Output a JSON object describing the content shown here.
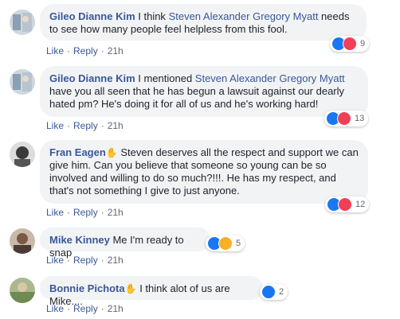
{
  "actions": {
    "like": "Like",
    "reply": "Reply",
    "dot": "·"
  },
  "comments": [
    {
      "author": "Gileo Dianne Kim",
      "pre": " I think ",
      "mention": "Steven Alexander Gregory Myatt",
      "post": " needs to see how many people feel helpless from this fool.",
      "time": "21h",
      "reaction_count": "9",
      "reactions": [
        "like-icon",
        "love-icon"
      ]
    },
    {
      "author": "Gileo Dianne Kim",
      "pre": " I mentioned ",
      "mention": "Steven Alexander Gregory Myatt",
      "post": " have you all seen that he has begun a lawsuit against our dearly hated pm? He's doing it for all of us and he's working hard!",
      "time": "21h",
      "reaction_count": "13",
      "reactions": [
        "like-icon",
        "love-icon"
      ]
    },
    {
      "author": "Fran Eagen",
      "emoji": "✋",
      "text": " Steven deserves all the respect and support we can give him. Can you believe that someone so young can be so involved and willing to do so much?!!!. He has my respect, and that's not something I give to just anyone.",
      "time": "21h",
      "reaction_count": "12",
      "reactions": [
        "like-icon",
        "love-icon"
      ]
    },
    {
      "author": "Mike Kinney",
      "text": " Me I'm ready to snap",
      "time": "21h",
      "reaction_count": "5",
      "reactions": [
        "like-icon",
        "sad-icon"
      ]
    },
    {
      "author": "Bonnie Pichota",
      "emoji": "✋",
      "text": " I think alot of us are Mike....",
      "time": "21h",
      "reaction_count": "2",
      "reactions": [
        "like-icon"
      ]
    }
  ]
}
